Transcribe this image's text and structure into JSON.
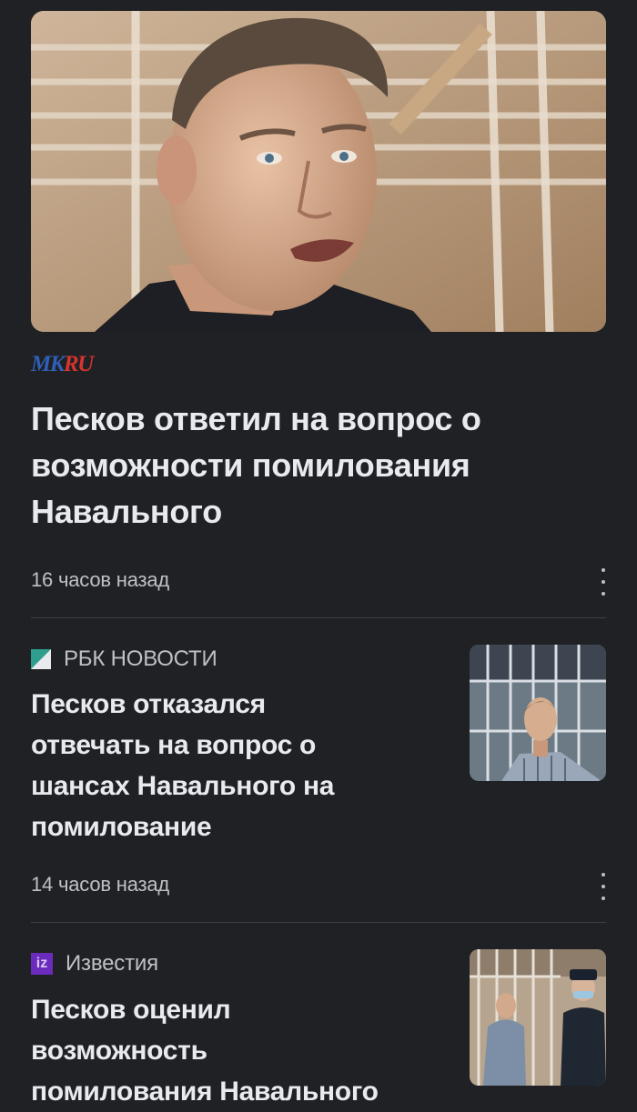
{
  "articles": [
    {
      "source": "MKRU",
      "source_logo": {
        "part1": "MK",
        "part2": "RU"
      },
      "headline_lines": [
        "Песков ответил на вопрос о",
        "возможности помилования",
        "Навального"
      ],
      "time": "16 часов назад",
      "menu_icon": "more-vert-icon"
    },
    {
      "source": "РБК НОВОСТИ",
      "headline_lines": [
        "Песков отказался",
        "отвечать на вопрос о",
        "шансах Навального на",
        "помилование"
      ],
      "time": "14 часов назад",
      "menu_icon": "more-vert-icon"
    },
    {
      "source": "Известия",
      "source_icon_text": "iz",
      "headline_lines": [
        "Песков оценил",
        "возможность",
        "помилования Навального"
      ]
    }
  ],
  "colors": {
    "background": "#202124",
    "headline": "#e8eaed",
    "secondary_text": "#bdc1c6",
    "divider": "#3c4043",
    "mk_blue": "#2f5fb6",
    "mk_red": "#d5342f",
    "izvestia_purple": "#6b2bbd"
  }
}
